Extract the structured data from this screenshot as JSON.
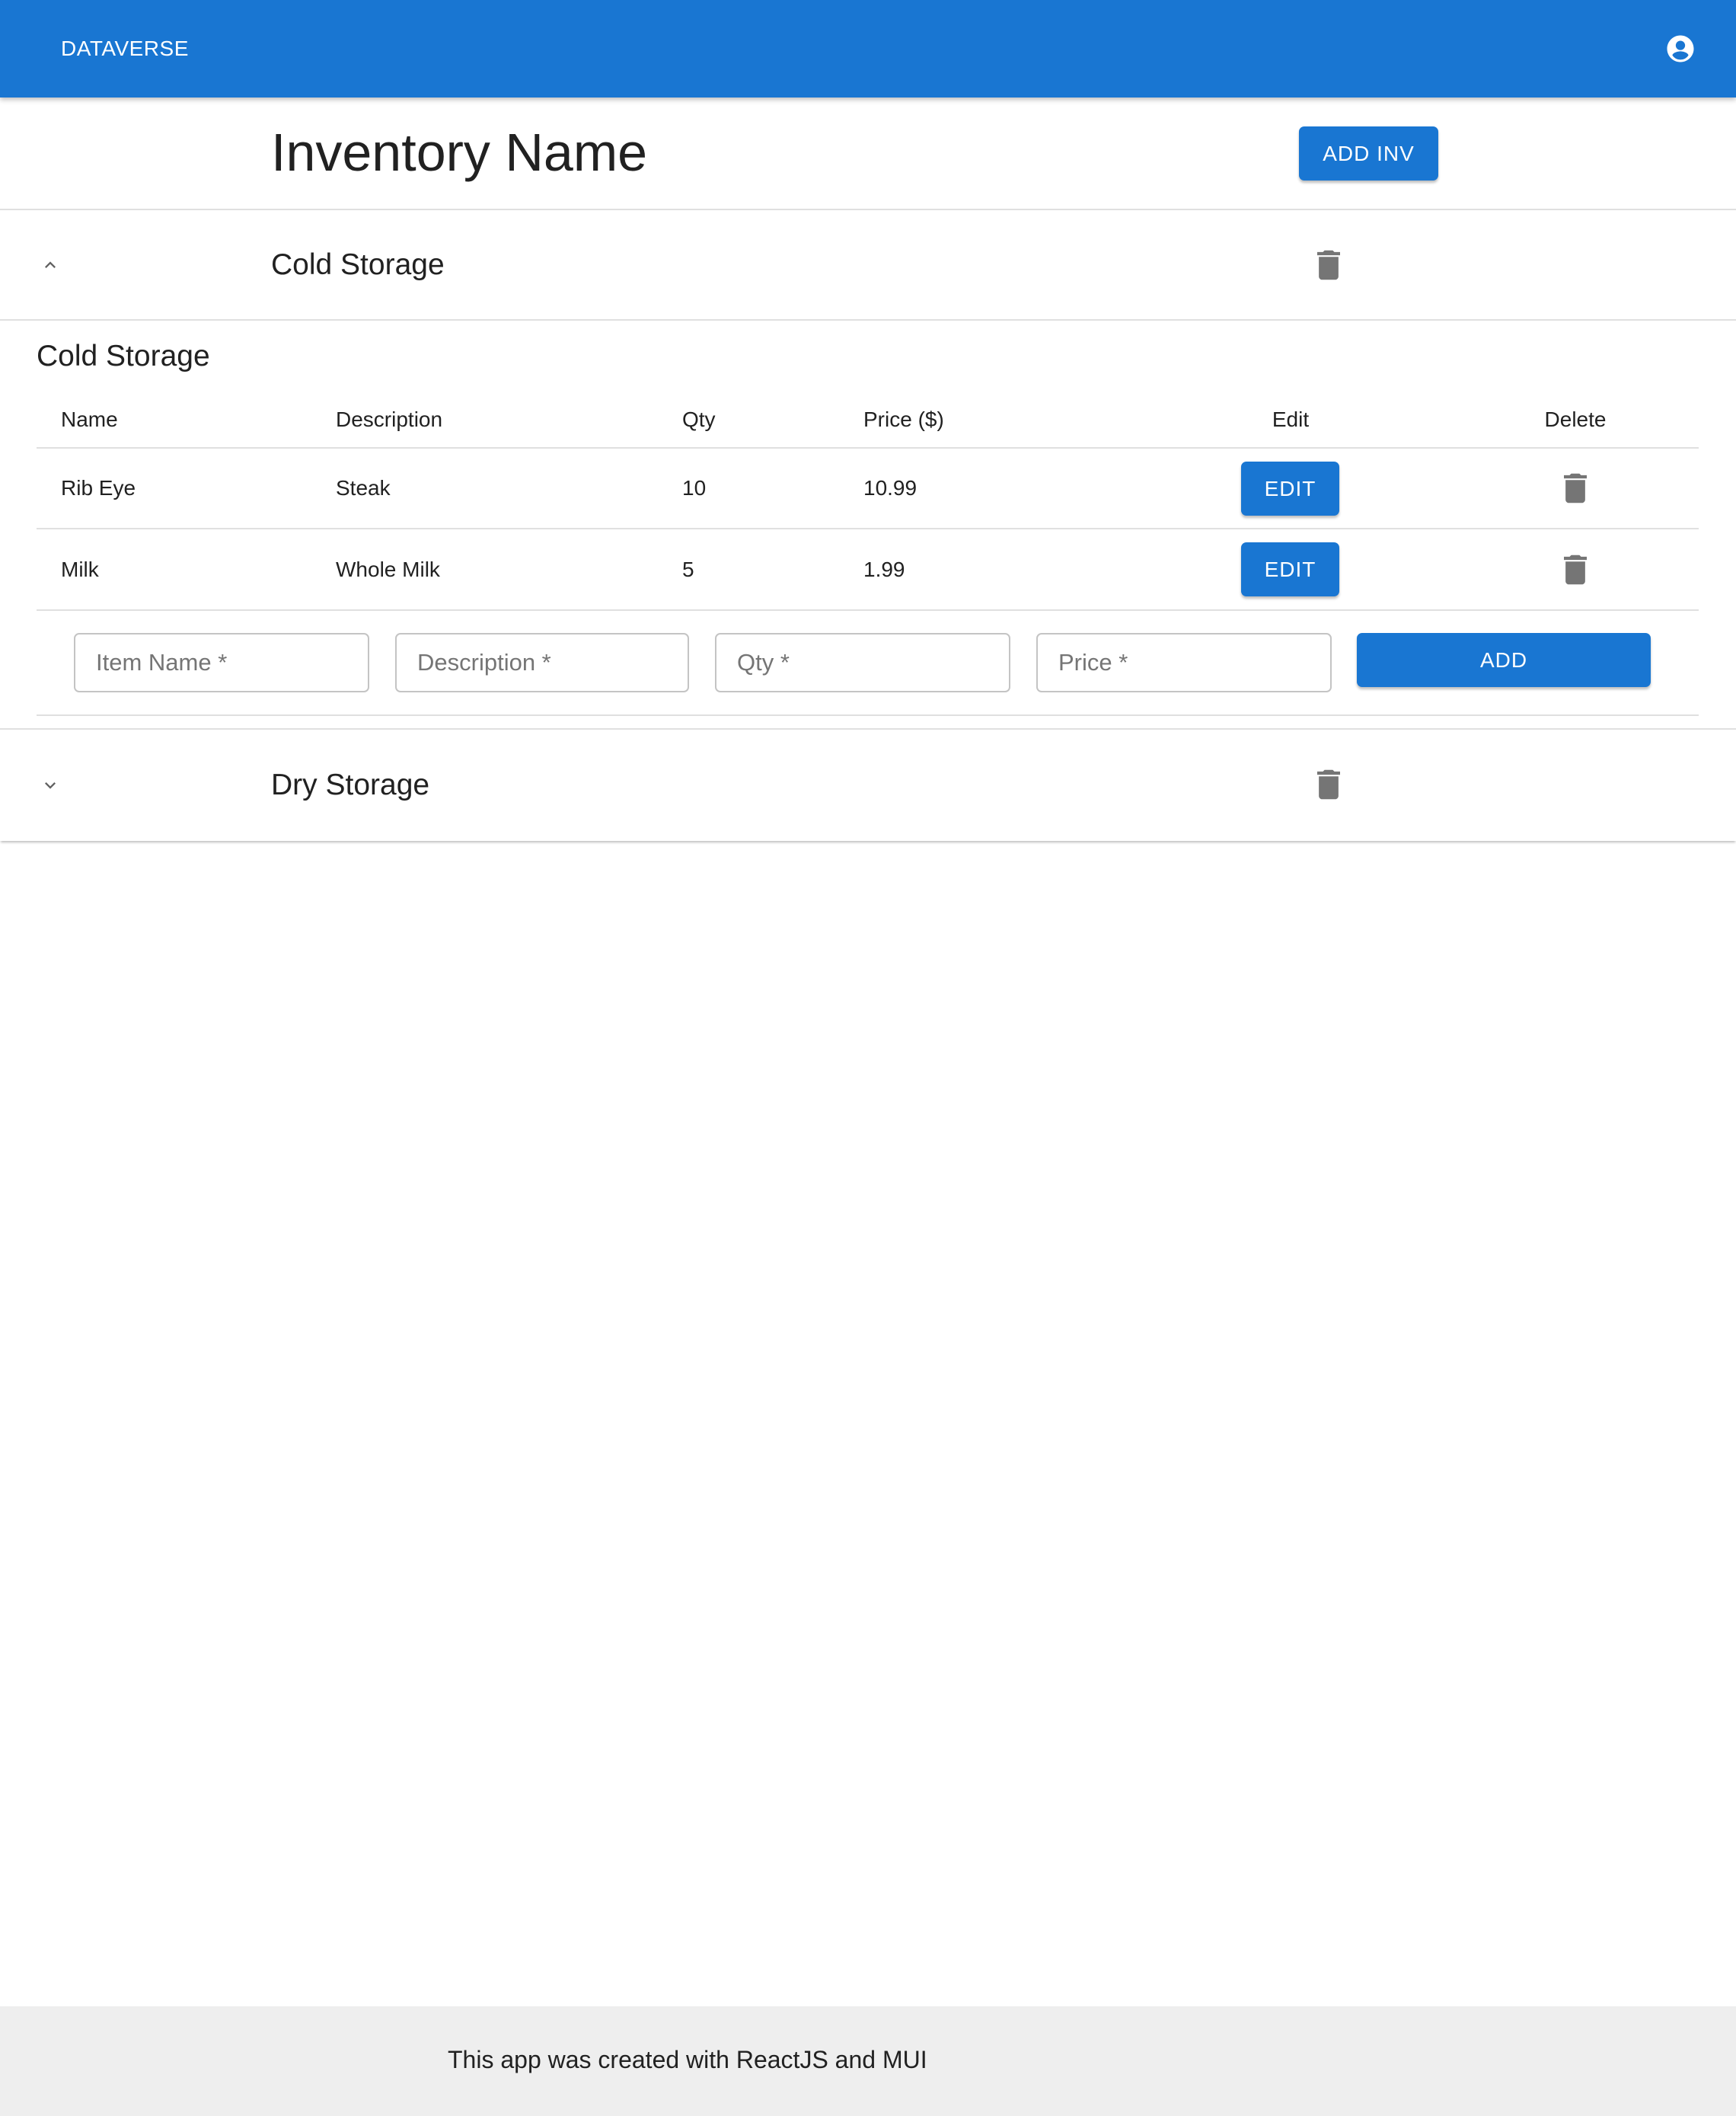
{
  "appbar": {
    "brand": "DATAVERSE",
    "account_icon": "account-circle-icon"
  },
  "page": {
    "title": "Inventory Name",
    "add_inventory_label": "ADD INV"
  },
  "inventories": [
    {
      "name": "Cold Storage",
      "expanded": true
    },
    {
      "name": "Dry Storage",
      "expanded": false
    }
  ],
  "detail": {
    "title": "Cold Storage",
    "columns": [
      "Name",
      "Description",
      "Qty",
      "Price ($)",
      "Edit",
      "Delete"
    ],
    "rows": [
      {
        "name": "Rib Eye",
        "description": "Steak",
        "qty": "10",
        "price": "10.99",
        "edit_label": "EDIT"
      },
      {
        "name": "Milk",
        "description": "Whole Milk",
        "qty": "5",
        "price": "1.99",
        "edit_label": "EDIT"
      }
    ],
    "form": {
      "item_name": "Item Name *",
      "description": "Description *",
      "qty": "Qty *",
      "price": "Price *",
      "add_label": "ADD"
    }
  },
  "colors": {
    "primary": "#1976d2",
    "icon_gray": "#757575",
    "footer_bg": "#eeeeee"
  },
  "footer": {
    "text": "This app was created with ReactJS and MUI"
  }
}
